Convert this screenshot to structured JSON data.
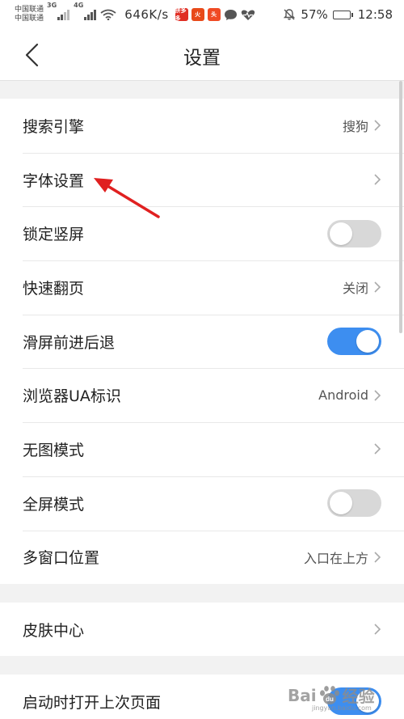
{
  "status_bar": {
    "carrier_1": "中国联通",
    "carrier_2": "中国联通",
    "net_1": "3G",
    "net_2": "4G",
    "speed": "646K/s",
    "battery": "57%",
    "battery_level": 0.57,
    "time": "12:58",
    "app_icon_1_label": "拼多多"
  },
  "header": {
    "title": "设置"
  },
  "settings": {
    "search_engine": {
      "label": "搜索引擎",
      "value": "搜狗"
    },
    "font_settings": {
      "label": "字体设置"
    },
    "lock_portrait": {
      "label": "锁定竖屏",
      "enabled": false
    },
    "quick_page_turn": {
      "label": "快速翻页",
      "value": "关闭"
    },
    "swipe_navigation": {
      "label": "滑屏前进后退",
      "enabled": true
    },
    "browser_ua": {
      "label": "浏览器UA标识",
      "value": "Android"
    },
    "no_image_mode": {
      "label": "无图模式"
    },
    "fullscreen_mode": {
      "label": "全屏模式",
      "enabled": false
    },
    "multiwindow_position": {
      "label": "多窗口位置",
      "value": "入口在上方"
    },
    "skin_center": {
      "label": "皮肤中心"
    },
    "restore_last_page": {
      "label": "启动时打开上次页面",
      "enabled": true
    }
  },
  "watermark": {
    "text_1": "Bai",
    "text_2": "经验",
    "sub": "jingyan.baidu.com"
  },
  "colors": {
    "accent": "#3d8ef0",
    "toggle_off": "#d8d8d8",
    "arrow": "#e02020"
  }
}
